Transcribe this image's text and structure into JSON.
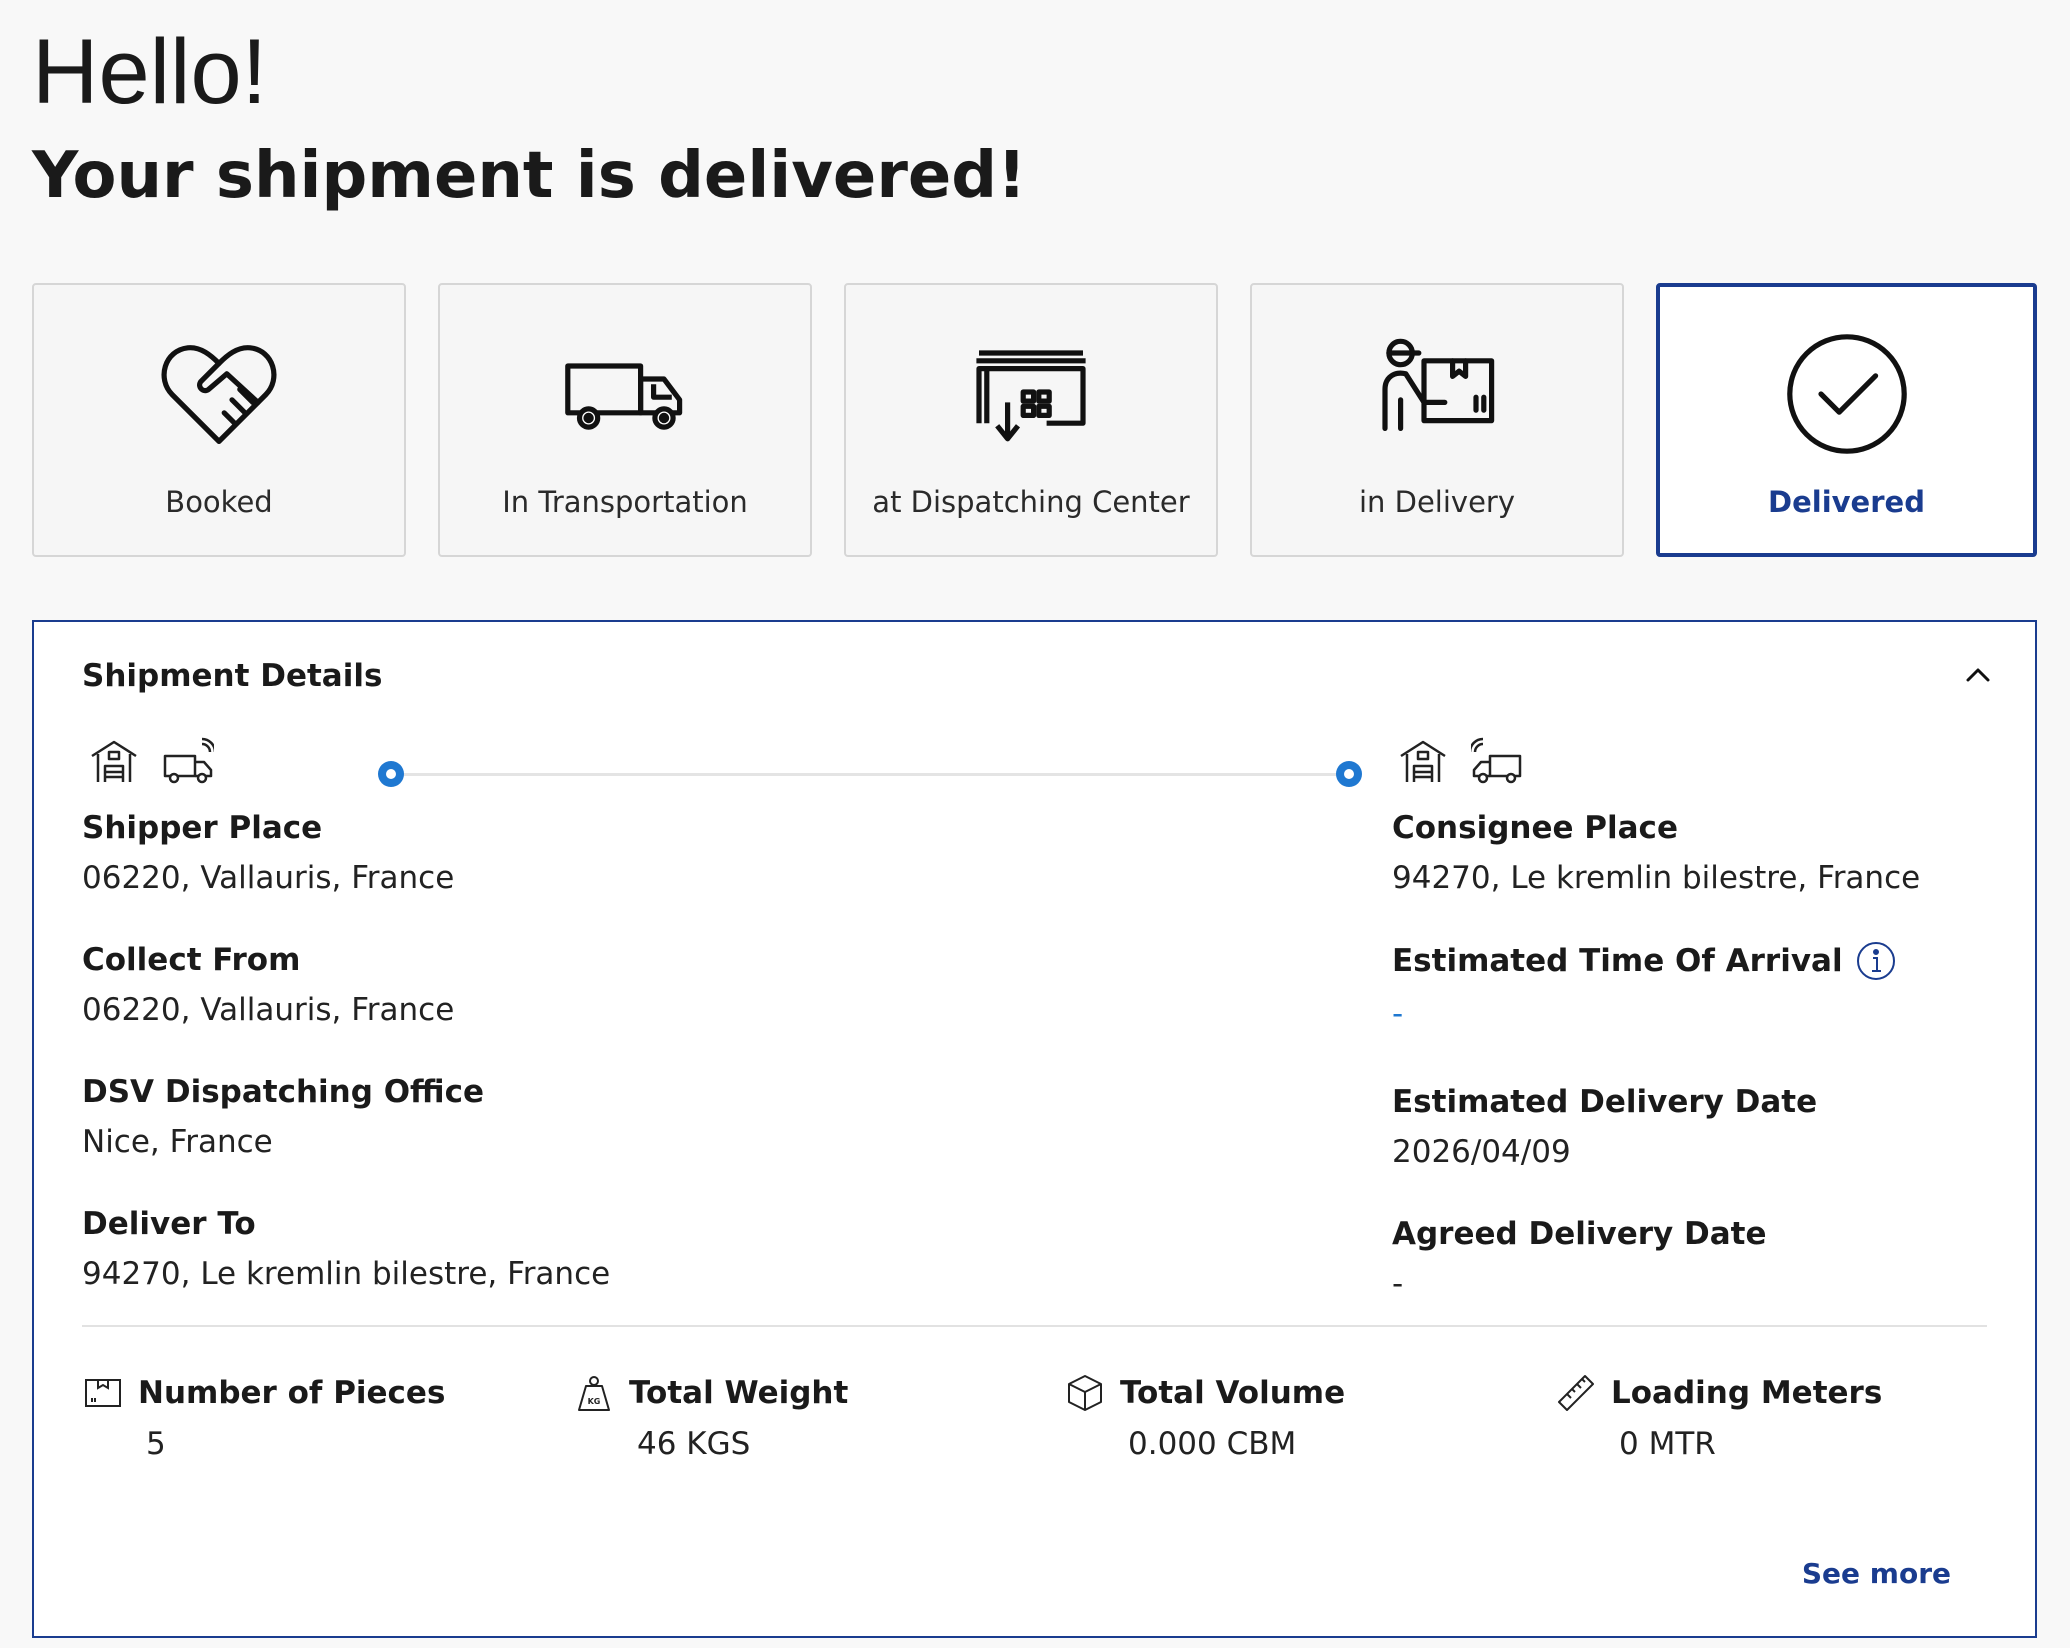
{
  "greeting": "Hello!",
  "headline": "Your shipment is delivered!",
  "steps": [
    {
      "label": "Booked",
      "icon": "handshake-icon"
    },
    {
      "label": "In Transportation",
      "icon": "truck-icon"
    },
    {
      "label": "at Dispatching Center",
      "icon": "warehouse-icon"
    },
    {
      "label": "in Delivery",
      "icon": "delivery-person-icon"
    },
    {
      "label": "Delivered",
      "icon": "check-circle-icon",
      "active": true
    }
  ],
  "details": {
    "title": "Shipment Details",
    "left": [
      {
        "label": "Shipper Place",
        "value": "06220, Vallauris, France"
      },
      {
        "label": "Collect From",
        "value": "06220, Vallauris, France"
      },
      {
        "label": "DSV Dispatching Office",
        "value": "Nice, France"
      },
      {
        "label": "Deliver To",
        "value": "94270, Le kremlin bilestre, France"
      }
    ],
    "right": [
      {
        "label": "Consignee Place",
        "value": "94270, Le kremlin bilestre, France"
      },
      {
        "label": "Estimated Time Of Arrival",
        "value": "-"
      },
      {
        "label": "Estimated Delivery Date",
        "value": "2026/04/09"
      },
      {
        "label": "Agreed Delivery Date",
        "value": "-"
      }
    ],
    "metrics": [
      {
        "label": "Number of Pieces",
        "value": "5",
        "icon": "box-icon"
      },
      {
        "label": "Total Weight",
        "value": "46 KGS",
        "icon": "weight-icon"
      },
      {
        "label": "Total Volume",
        "value": "0.000 CBM",
        "icon": "cube-icon"
      },
      {
        "label": "Loading Meters",
        "value": "0 MTR",
        "icon": "ruler-icon"
      }
    ],
    "see_more": "See more"
  },
  "colors": {
    "accent": "#1a3c8f",
    "dot": "#1f78d1"
  }
}
